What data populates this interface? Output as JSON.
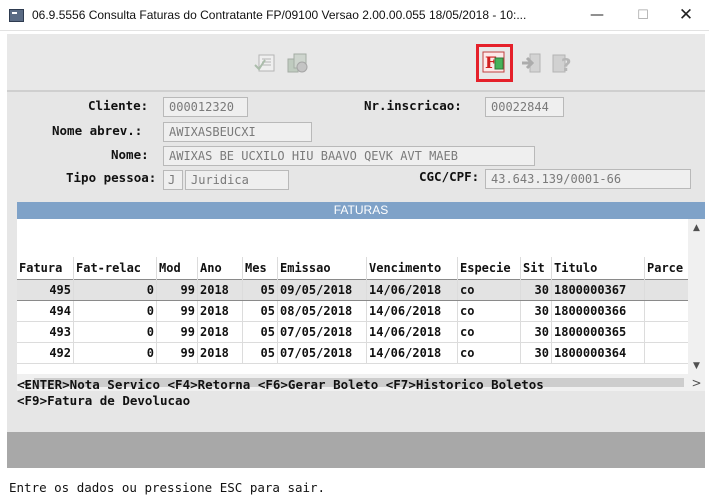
{
  "window": {
    "title": "06.9.5556 Consulta  Faturas do Contratante FP/09100 Versao 2.00.00.055 18/05/2018 - 10:...",
    "minimize": "—",
    "maximize": "☐",
    "close": "✕"
  },
  "toolbar": {
    "buttons": [
      {
        "icon": "list-icon",
        "enabled": false
      },
      {
        "icon": "invoice-stack-icon",
        "enabled": false
      },
      {
        "icon": "fatura-devolucao-icon",
        "text": "F",
        "enabled": true,
        "highlighted": true
      },
      {
        "icon": "exit-icon",
        "enabled": false
      },
      {
        "icon": "help-icon",
        "enabled": false
      }
    ],
    "highlight_color": "#e5202a"
  },
  "header": {
    "cliente_label": "Cliente:",
    "cliente_value": "000012320",
    "nr_inscricao_label": "Nr.inscricao:",
    "nr_inscricao_value": "00022844",
    "nome_abrev_label": "Nome abrev.:",
    "nome_abrev_value": "AWIXASBEUCXI",
    "nome_label": "Nome:",
    "nome_value": "AWIXAS BE UCXILO HIU BAAVO QEVK AVT MAEB",
    "tipo_pessoa_label": "Tipo pessoa:",
    "tipo_pessoa_code": "J",
    "tipo_pessoa_value": "Juridica",
    "cgc_cpf_label": "CGC/CPF:",
    "cgc_cpf_value": "43.643.139/0001-66"
  },
  "grid": {
    "title": "FATURAS",
    "title_bar_color": "#7fa2c8",
    "columns": [
      "Fatura",
      "Fat-relac",
      "Mod",
      "Ano",
      "Mes",
      "Emissao",
      "Vencimento",
      "Especie",
      "Sit",
      "Titulo",
      "Parce"
    ],
    "rows": [
      [
        "495",
        "0",
        "99",
        "2018",
        "05",
        "09/05/2018",
        "14/06/2018",
        "co",
        "30",
        "1800000367",
        ""
      ],
      [
        "494",
        "0",
        "99",
        "2018",
        "05",
        "08/05/2018",
        "14/06/2018",
        "co",
        "30",
        "1800000366",
        ""
      ],
      [
        "493",
        "0",
        "99",
        "2018",
        "05",
        "07/05/2018",
        "14/06/2018",
        "co",
        "30",
        "1800000365",
        ""
      ],
      [
        "492",
        "0",
        "99",
        "2018",
        "05",
        "07/05/2018",
        "14/06/2018",
        "co",
        "30",
        "1800000364",
        ""
      ]
    ],
    "selected_row": 0,
    "scroll_up": "▲",
    "scroll_down": "▼",
    "scroll_left": "<",
    "scroll_right": ">"
  },
  "hints": {
    "line1": "<ENTER>Nota Servico <F4>Retorna <F6>Gerar Boleto <F7>Historico Boletos",
    "line2": "<F9>Fatura de Devolucao"
  },
  "status": "Entre os dados ou pressione ESC para sair."
}
